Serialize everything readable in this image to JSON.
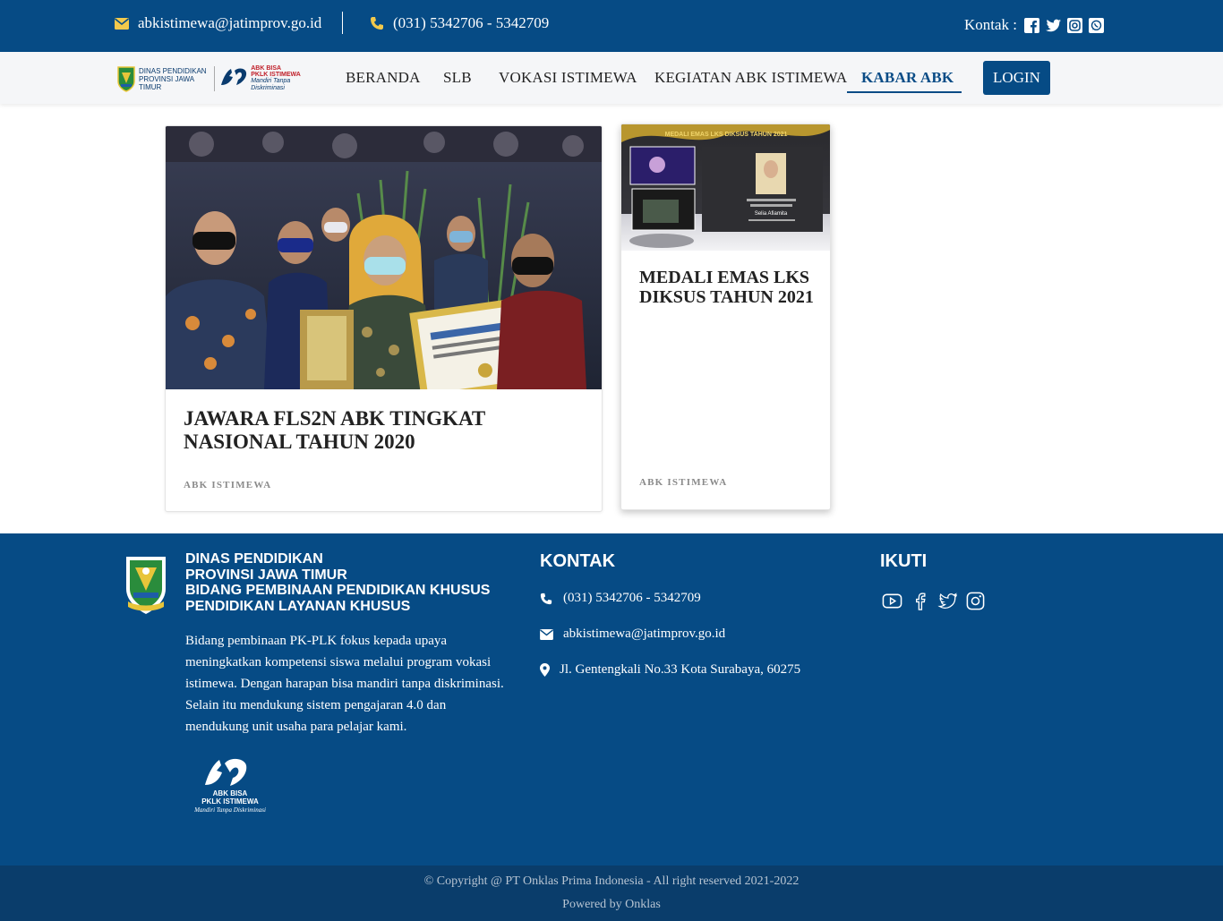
{
  "topbar": {
    "email": "abkistimewa@jatimprov.go.id",
    "phone": "(031) 5342706 - 5342709",
    "kontak_label": "Kontak :",
    "social_icons": [
      "facebook-square-icon",
      "twitter-icon",
      "instagram-icon",
      "whatsapp-icon"
    ]
  },
  "navbar": {
    "logo_text_line1": "DINAS PENDIDIKAN",
    "logo_text_line2": "PROVINSI JAWA TIMUR",
    "logo_abk_line1": "ABK BISA",
    "logo_abk_line2": "PKLK ISTIMEWA",
    "logo_abk_tagline": "Mandiri Tanpa Diskriminasi",
    "items": [
      "BERANDA",
      "SLB",
      "VOKASI ISTIMEWA",
      "KEGIATAN ABK ISTIMEWA",
      "KABAR ABK"
    ],
    "active_item": "KABAR ABK",
    "login_label": "LOGIN"
  },
  "cards": [
    {
      "title": "JAWARA FLS2N ABK TINGKAT NASIONAL TAHUN 2020",
      "category": "ABK ISTIMEWA"
    },
    {
      "title": "MEDALI EMAS LKS DIKSUS TAHUN 2021",
      "category": "ABK ISTIMEWA",
      "image_banner": "MEDALI EMAS LKS DIKSUS TAHUN 2021",
      "image_name": "Selia Afiamita"
    }
  ],
  "footer": {
    "org_lines": [
      "DINAS PENDIDIKAN",
      "PROVINSI JAWA TIMUR",
      "BIDANG PEMBINAAN PENDIDIKAN KHUSUS",
      "PENDIDIKAN LAYANAN KHUSUS"
    ],
    "description": "Bidang pembinaan PK-PLK fokus kepada upaya meningkatkan kompetensi siswa melalui program vokasi istimewa. Dengan harapan bisa mandiri tanpa diskriminasi. Selain itu mendukung sistem pengajaran 4.0 dan mendukung unit usaha para pelajar kami.",
    "abk_logo_line1": "ABK BISA",
    "abk_logo_line2": "PKLK ISTIMEWA",
    "abk_logo_tagline": "Mandiri Tanpa Diskriminasi",
    "kontak_heading": "KONTAK",
    "phone": "(031) 5342706 - 5342709",
    "email": "abkistimewa@jatimprov.go.id",
    "address": "Jl. Gentengkali No.33 Kota Surabaya, 60275",
    "ikuti_heading": "IKUTI",
    "social_icons": [
      "youtube-icon",
      "facebook-icon",
      "twitter-icon",
      "instagram-icon"
    ]
  },
  "copyright": {
    "line1": "© Copyright @ PT Onklas Prima Indonesia - All right reserved 2021-2022",
    "line2": "Powered by Onklas"
  },
  "colors": {
    "primary": "#064b85",
    "accent_icon": "#f2c94c",
    "copyright_bg": "#0a3d6b"
  }
}
